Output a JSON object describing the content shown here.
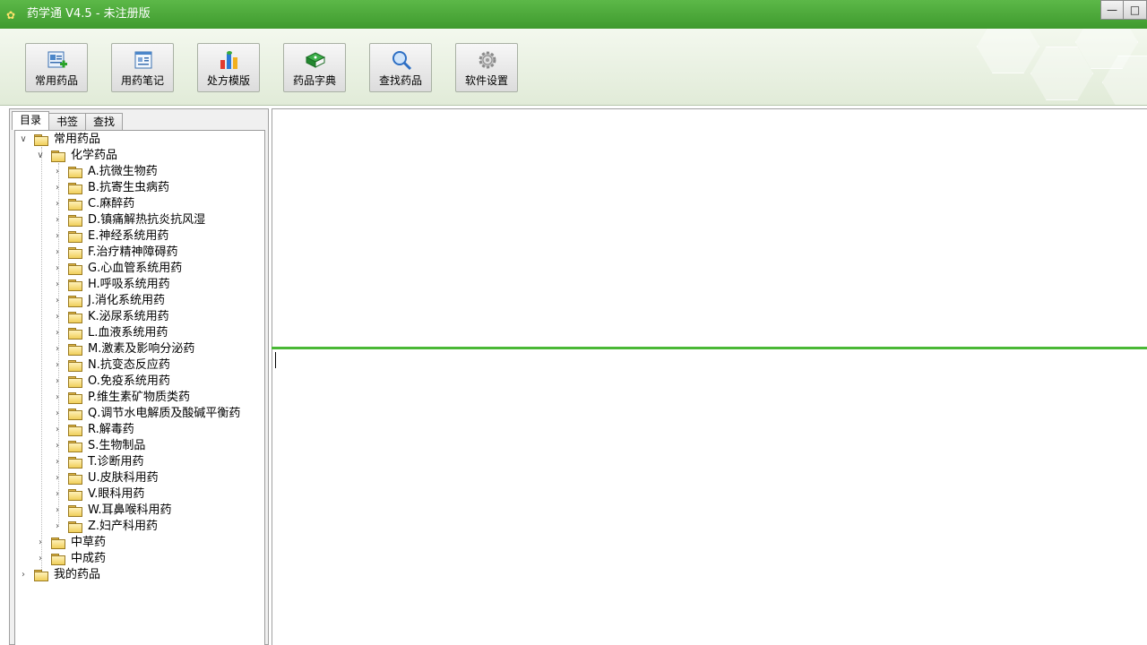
{
  "window": {
    "title": "药学通 V4.5 - 未注册版",
    "controls": [
      "minimize",
      "maximize"
    ]
  },
  "toolbar": {
    "buttons": [
      {
        "label": "常用药品",
        "icon": "drug-list-icon"
      },
      {
        "label": "用药笔记",
        "icon": "notes-icon"
      },
      {
        "label": "处方模版",
        "icon": "prescription-icon"
      },
      {
        "label": "药品字典",
        "icon": "dictionary-book-icon"
      },
      {
        "label": "查找药品",
        "icon": "magnifier-icon"
      },
      {
        "label": "软件设置",
        "icon": "gear-icon"
      }
    ]
  },
  "sidebar": {
    "tabs": [
      {
        "label": "目录",
        "active": true
      },
      {
        "label": "书签",
        "active": false
      },
      {
        "label": "查找",
        "active": false
      }
    ],
    "tree": {
      "root": {
        "label": "常用药品",
        "expanded": true
      },
      "chemical": {
        "label": "化学药品",
        "expanded": true
      },
      "categories": [
        "A.抗微生物药",
        "B.抗寄生虫病药",
        "C.麻醉药",
        "D.镇痛解热抗炎抗风湿",
        "E.神经系统用药",
        "F.治疗精神障碍药",
        "G.心血管系统用药",
        "H.呼吸系统用药",
        "J.消化系统用药",
        "K.泌尿系统用药",
        "L.血液系统用药",
        "M.激素及影响分泌药",
        "N.抗变态反应药",
        "O.免疫系统用药",
        "P.维生素矿物质类药",
        "Q.调节水电解质及酸碱平衡药",
        "R.解毒药",
        "S.生物制品",
        "T.诊断用药",
        "U.皮肤科用药",
        "V.眼科用药",
        "W.耳鼻喉科用药",
        "Z.妇产科用药"
      ],
      "herbal": {
        "label": "中草药"
      },
      "patent": {
        "label": "中成药"
      },
      "mine": {
        "label": "我的药品"
      }
    }
  },
  "colors": {
    "titlebar": "#4aa838",
    "splitter": "#4ab836",
    "folder": "#f0cf5a"
  }
}
